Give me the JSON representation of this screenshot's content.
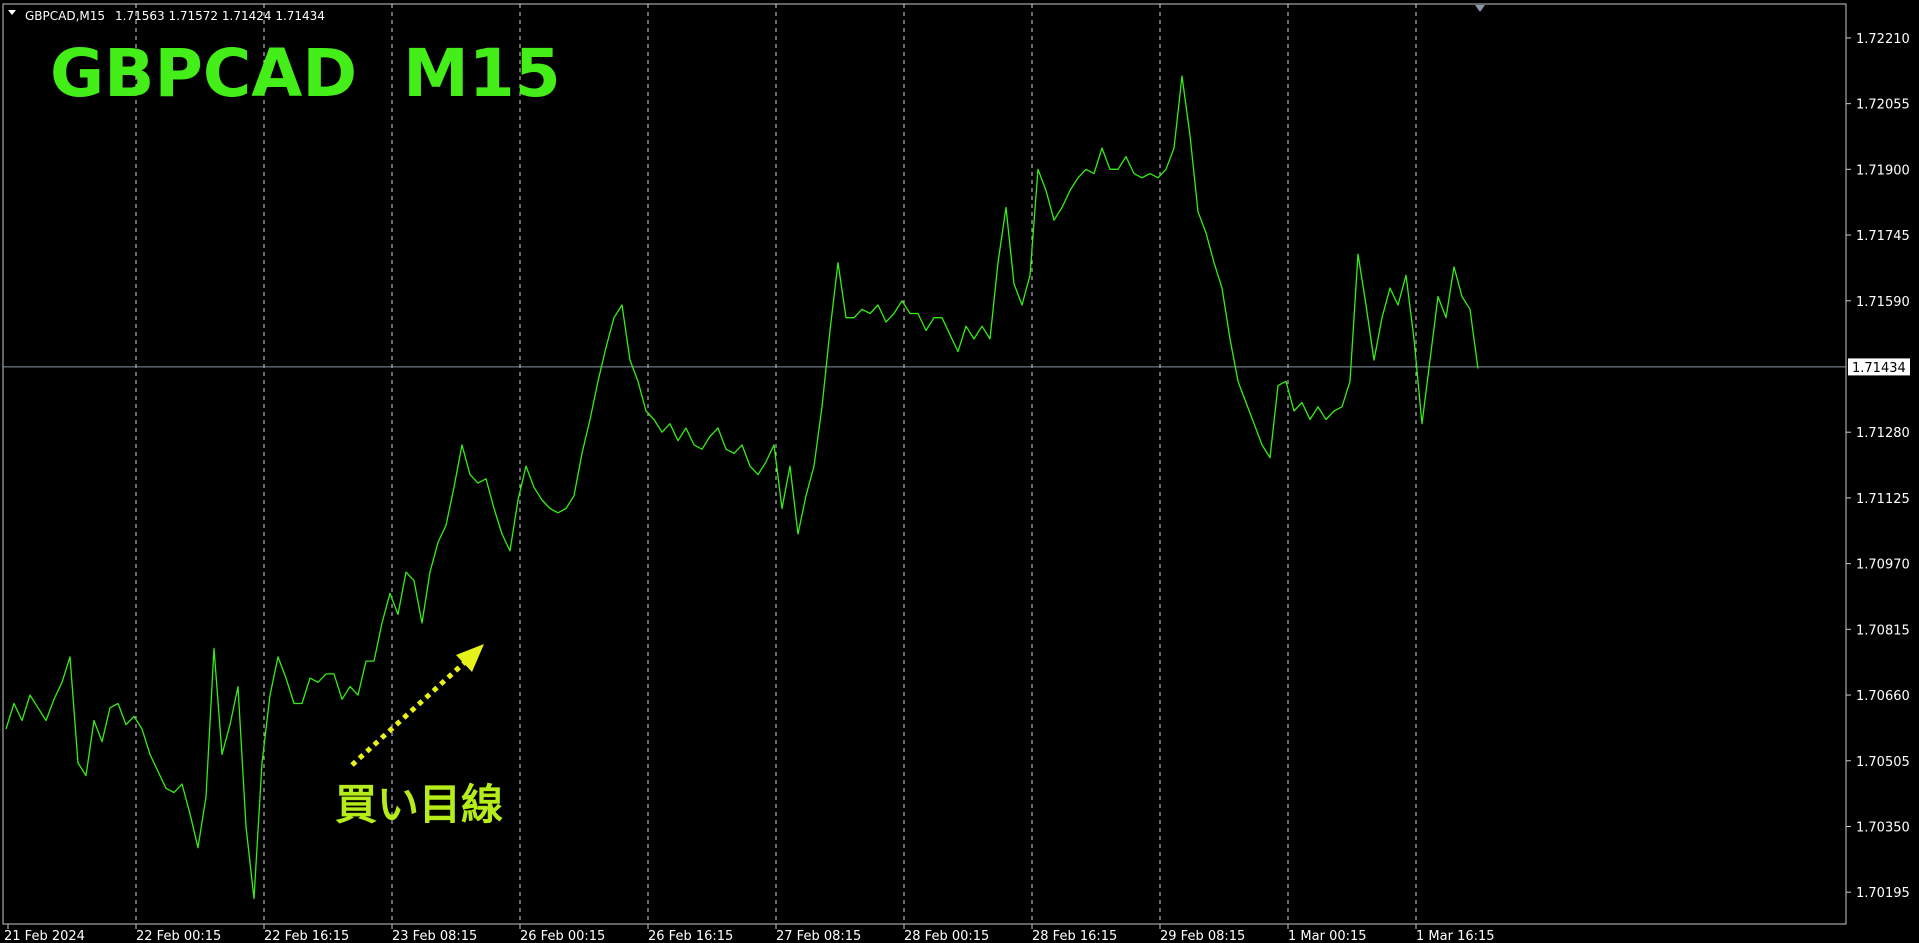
{
  "header": {
    "symbol_label": "GBPCAD,M15",
    "ohlc": "1.71563 1.71572 1.71424 1.71434"
  },
  "chart_title": "GBPCAD  M15",
  "annotation_text": "買い目線",
  "current_price_label": "1.71434",
  "colors": {
    "background": "#000000",
    "price_line": "#33ee11",
    "grid": "#ffffff",
    "annotation": "#b5ec1a",
    "title": "#44ee18",
    "current_price_line": "#8a96a8"
  },
  "chart_data": {
    "type": "line",
    "title": "GBPCAD  M15",
    "xlabel": "",
    "ylabel": "",
    "ylim": [
      1.7012,
      1.7229
    ],
    "y_ticks": [
      "1.72210",
      "1.72055",
      "1.71900",
      "1.71745",
      "1.71590",
      "1.71434",
      "1.71280",
      "1.71125",
      "1.70970",
      "1.70815",
      "1.70660",
      "1.70505",
      "1.70350",
      "1.70195"
    ],
    "y_tick_values": [
      1.7221,
      1.72055,
      1.719,
      1.71745,
      1.7159,
      1.71434,
      1.7128,
      1.71125,
      1.7097,
      1.70815,
      1.7066,
      1.70505,
      1.7035,
      1.70195
    ],
    "x_tick_labels": [
      "21 Feb 2024",
      "22 Feb 00:15",
      "22 Feb 16:15",
      "23 Feb 08:15",
      "26 Feb 00:15",
      "26 Feb 16:15",
      "27 Feb 08:15",
      "28 Feb 00:15",
      "28 Feb 16:15",
      "29 Feb 08:15",
      "1 Mar 00:15",
      "1 Mar 16:15"
    ],
    "x_tick_index": [
      0,
      16,
      32,
      48,
      64,
      80,
      96,
      112,
      128,
      144,
      160,
      176
    ],
    "grid": "vertical-dashed",
    "current_price": 1.71434,
    "series": [
      {
        "values": [
          1.7058,
          1.7064,
          1.706,
          1.7066,
          1.7063,
          1.706,
          1.7065,
          1.7069,
          1.7075,
          1.705,
          1.7047,
          1.706,
          1.7055,
          1.7063,
          1.7064,
          1.7059,
          1.7061,
          1.7058,
          1.7052,
          1.7048,
          1.7044,
          1.7043,
          1.7045,
          1.7038,
          1.703,
          1.7042,
          1.7077,
          1.7052,
          1.7059,
          1.7068,
          1.7035,
          1.7018,
          1.705,
          1.7066,
          1.7075,
          1.707,
          1.7064,
          1.7064,
          1.707,
          1.7069,
          1.7071,
          1.7071,
          1.7065,
          1.7068,
          1.7066,
          1.7074,
          1.7074,
          1.7083,
          1.709,
          1.7085,
          1.7095,
          1.7093,
          1.7083,
          1.7095,
          1.7102,
          1.7106,
          1.7115,
          1.7125,
          1.7118,
          1.7116,
          1.7117,
          1.711,
          1.7104,
          1.71,
          1.7112,
          1.712,
          1.7115,
          1.7112,
          1.711,
          1.7109,
          1.711,
          1.7113,
          1.7123,
          1.7131,
          1.714,
          1.7148,
          1.7155,
          1.7158,
          1.7145,
          1.714,
          1.7133,
          1.7131,
          1.7128,
          1.713,
          1.7126,
          1.7129,
          1.7125,
          1.7124,
          1.7127,
          1.7129,
          1.7124,
          1.7123,
          1.7125,
          1.712,
          1.7118,
          1.7121,
          1.7125,
          1.711,
          1.712,
          1.7104,
          1.7113,
          1.712,
          1.7134,
          1.7152,
          1.7168,
          1.7155,
          1.7155,
          1.7157,
          1.7156,
          1.7158,
          1.7154,
          1.7156,
          1.7159,
          1.7156,
          1.7156,
          1.7152,
          1.7155,
          1.7155,
          1.7151,
          1.7147,
          1.7153,
          1.715,
          1.7153,
          1.715,
          1.7168,
          1.7181,
          1.7163,
          1.7158,
          1.7165,
          1.719,
          1.7185,
          1.7178,
          1.7181,
          1.7185,
          1.7188,
          1.719,
          1.7189,
          1.7195,
          1.719,
          1.719,
          1.7193,
          1.7189,
          1.7188,
          1.7189,
          1.7188,
          1.719,
          1.7195,
          1.7212,
          1.7198,
          1.718,
          1.7175,
          1.7168,
          1.7162,
          1.715,
          1.714,
          1.7135,
          1.713,
          1.7125,
          1.7122,
          1.7139,
          1.714,
          1.7133,
          1.7135,
          1.7131,
          1.7134,
          1.7131,
          1.7133,
          1.7134,
          1.714,
          1.717,
          1.7158,
          1.7145,
          1.7155,
          1.7162,
          1.7158,
          1.7165,
          1.715,
          1.713,
          1.7145,
          1.716,
          1.7155,
          1.7167,
          1.716,
          1.7157,
          1.7143
        ]
      }
    ]
  }
}
